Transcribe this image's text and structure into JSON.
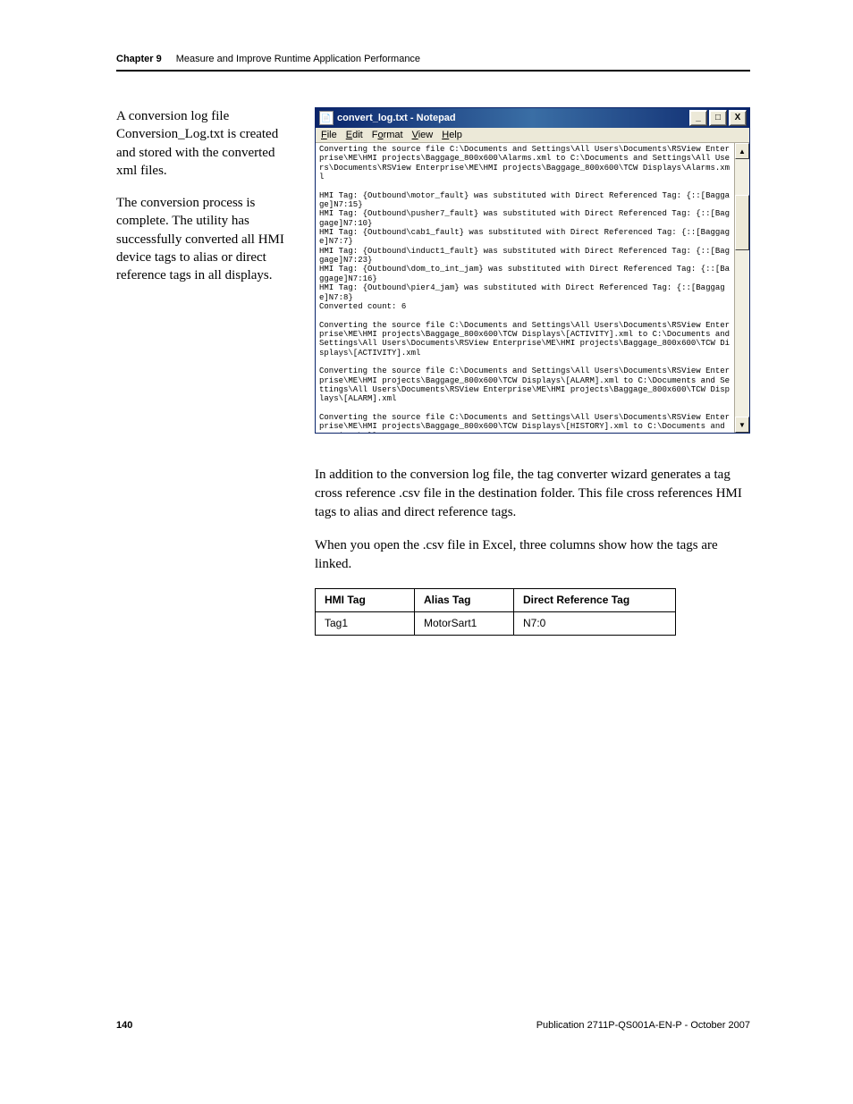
{
  "header": {
    "chapter_label": "Chapter 9",
    "chapter_title": "Measure and Improve Runtime Application Performance"
  },
  "side_text": {
    "p1": "A conversion log file Conversion_Log.txt is created and stored with the converted xml files.",
    "p2": "The conversion process is complete. The utility has successfully converted all HMI device tags to alias or direct reference tags in all displays."
  },
  "notepad": {
    "title": "convert_log.txt - Notepad",
    "minimize": "_",
    "maximize": "□",
    "close": "X",
    "menus": {
      "file": "File",
      "edit": "Edit",
      "format": "Format",
      "view": "View",
      "help": "Help"
    },
    "scroll_up": "▲",
    "scroll_down": "▼",
    "body": "Converting the source file C:\\Documents and Settings\\All Users\\Documents\\RSView Enterprise\\ME\\HMI projects\\Baggage_800x600\\Alarms.xml to C:\\Documents and Settings\\All Users\\Documents\\RSView Enterprise\\ME\\HMI projects\\Baggage_800x600\\TCW Displays\\Alarms.xml\n\nHMI Tag: {Outbound\\motor_fault} was substituted with Direct Referenced Tag: {::[Baggage]N7:15}\nHMI Tag: {Outbound\\pusher7_fault} was substituted with Direct Referenced Tag: {::[Baggage]N7:10}\nHMI Tag: {Outbound\\cab1_fault} was substituted with Direct Referenced Tag: {::[Baggage]N7:7}\nHMI Tag: {Outbound\\induct1_fault} was substituted with Direct Referenced Tag: {::[Baggage]N7:23}\nHMI Tag: {Outbound\\dom_to_int_jam} was substituted with Direct Referenced Tag: {::[Baggage]N7:16}\nHMI Tag: {Outbound\\pier4_jam} was substituted with Direct Referenced Tag: {::[Baggage]N7:8}\nConverted count: 6\n\nConverting the source file C:\\Documents and Settings\\All Users\\Documents\\RSView Enterprise\\ME\\HMI projects\\Baggage_800x600\\TCW Displays\\[ACTIVITY].xml to C:\\Documents and Settings\\All Users\\Documents\\RSView Enterprise\\ME\\HMI projects\\Baggage_800x600\\TCW Displays\\[ACTIVITY].xml\n\nConverting the source file C:\\Documents and Settings\\All Users\\Documents\\RSView Enterprise\\ME\\HMI projects\\Baggage_800x600\\TCW Displays\\[ALARM].xml to C:\\Documents and Settings\\All Users\\Documents\\RSView Enterprise\\ME\\HMI projects\\Baggage_800x600\\TCW Displays\\[ALARM].xml\n\nConverting the source file C:\\Documents and Settings\\All Users\\Documents\\RSView Enterprise\\ME\\HMI projects\\Baggage_800x600\\TCW Displays\\[HISTORY].xml to C:\\Documents and Settings\\All"
  },
  "body_text": {
    "p1": "In addition to the conversion log file, the tag converter wizard generates a tag cross reference .csv file in the destination folder. This file cross references HMI tags to alias and direct reference tags.",
    "p2": "When you open the .csv file in Excel, three columns show how the tags are linked."
  },
  "table": {
    "headers": {
      "hmi": "HMI Tag",
      "alias": "Alias Tag",
      "direct": "Direct Reference Tag"
    },
    "row": {
      "hmi": "Tag1",
      "alias": "MotorSart1",
      "direct": "N7:0"
    }
  },
  "footer": {
    "page": "140",
    "pub": "Publication 2711P-QS001A-EN-P - October 2007"
  }
}
